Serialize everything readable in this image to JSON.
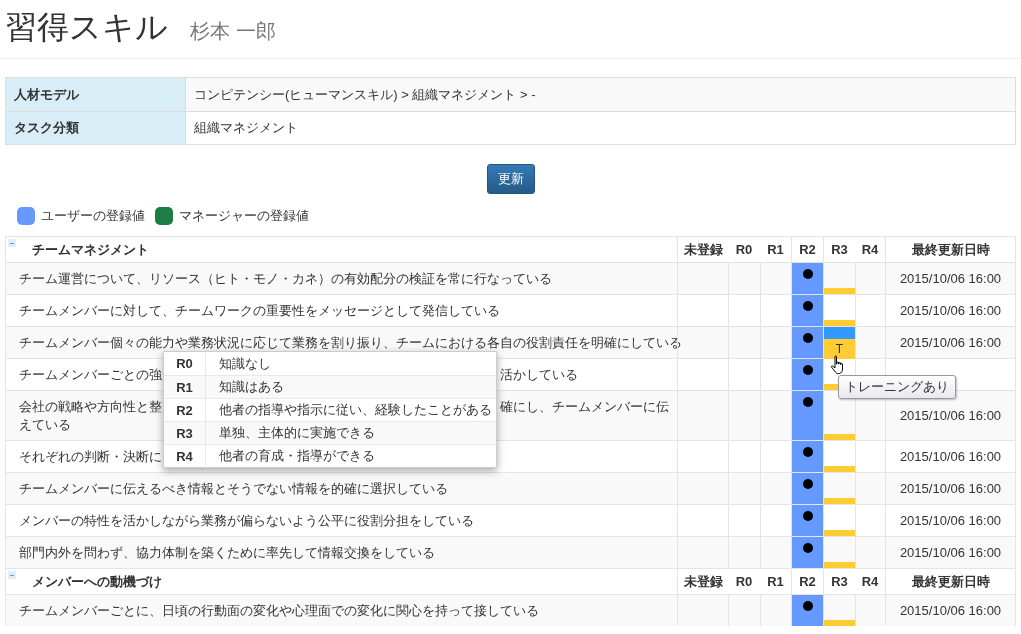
{
  "title": "習得スキル",
  "user_name": "杉本 一郎",
  "info": [
    {
      "label": "人材モデル",
      "value": "コンピテンシー(ヒューマンスキル) > 組織マネジメント > -"
    },
    {
      "label": "タスク分類",
      "value": "組織マネジメント"
    }
  ],
  "update_button": "更新",
  "legend": [
    {
      "label": "ユーザーの登録値",
      "color": "#6699ff"
    },
    {
      "label": "マネージャーの登録値",
      "color": "#1e7e45"
    }
  ],
  "groups": [
    {
      "title": "チームマネジメント",
      "expanded": true,
      "columns": [
        "未登録",
        "R0",
        "R1",
        "R2",
        "R3",
        "R4"
      ],
      "date_header": "最終更新日時",
      "rows": [
        {
          "lines": [
            [
              "チーム運営について、リソース（ヒト・モノ・カネ）の有効配分の検証を常に行なっている"
            ]
          ],
          "cells": [
            {
              "kind": "empty"
            },
            {
              "kind": "empty"
            },
            {
              "kind": "empty"
            },
            {
              "kind": "user"
            },
            {
              "kind": "training"
            },
            {
              "kind": "empty"
            }
          ],
          "date": "2015/10/06 16:00"
        },
        {
          "lines": [
            [
              "チームメンバーに対して、チームワークの重要性をメッセージとして発信している"
            ]
          ],
          "cells": [
            {
              "kind": "empty"
            },
            {
              "kind": "empty"
            },
            {
              "kind": "empty"
            },
            {
              "kind": "user"
            },
            {
              "kind": "training"
            },
            {
              "kind": "empty"
            }
          ],
          "date": "2015/10/06 16:00"
        },
        {
          "lines": [
            [
              "チームメンバー個々の能力や業務状況に応じて業務を割り振り、チームにおける各自の役割責任を明確にしている"
            ]
          ],
          "cells": [
            {
              "kind": "empty"
            },
            {
              "kind": "empty"
            },
            {
              "kind": "empty"
            },
            {
              "kind": "user"
            },
            {
              "kind": "training_hovered",
              "label": "T"
            },
            {
              "kind": "empty"
            }
          ],
          "date": "2015/10/06 16:00"
        },
        {
          "lines": [
            [
              "チームメンバーごとの強",
              "活かしている"
            ]
          ],
          "cells": [
            {
              "kind": "empty"
            },
            {
              "kind": "empty"
            },
            {
              "kind": "empty"
            },
            {
              "kind": "user"
            },
            {
              "kind": "training"
            },
            {
              "kind": "empty"
            }
          ]
        },
        {
          "lines": [
            [
              "会社の戦略や方向性と整",
              "確にし、チームメンバーに伝"
            ],
            [
              "えている"
            ]
          ],
          "cells": [
            {
              "kind": "empty"
            },
            {
              "kind": "empty"
            },
            {
              "kind": "empty"
            },
            {
              "kind": "user"
            },
            {
              "kind": "training"
            },
            {
              "kind": "empty"
            }
          ],
          "date": "2015/10/06 16:00"
        },
        {
          "lines": [
            [
              "それぞれの判断・決断に"
            ]
          ],
          "cells": [
            {
              "kind": "empty"
            },
            {
              "kind": "empty"
            },
            {
              "kind": "empty"
            },
            {
              "kind": "user"
            },
            {
              "kind": "training"
            },
            {
              "kind": "empty"
            }
          ],
          "date": "2015/10/06 16:00"
        },
        {
          "lines": [
            [
              "チームメンバーに伝えるべき情報とそうでない情報を的確に選択している"
            ]
          ],
          "cells": [
            {
              "kind": "empty"
            },
            {
              "kind": "empty"
            },
            {
              "kind": "empty"
            },
            {
              "kind": "user"
            },
            {
              "kind": "training"
            },
            {
              "kind": "empty"
            }
          ],
          "date": "2015/10/06 16:00"
        },
        {
          "lines": [
            [
              "メンバーの特性を活かしながら業務が偏らないよう公平に役割分担をしている"
            ]
          ],
          "cells": [
            {
              "kind": "empty"
            },
            {
              "kind": "empty"
            },
            {
              "kind": "empty"
            },
            {
              "kind": "user"
            },
            {
              "kind": "training"
            },
            {
              "kind": "empty"
            }
          ],
          "date": "2015/10/06 16:00"
        },
        {
          "lines": [
            [
              "部門内外を問わず、協力体制を築くために率先して情報交換をしている"
            ]
          ],
          "cells": [
            {
              "kind": "empty"
            },
            {
              "kind": "empty"
            },
            {
              "kind": "empty"
            },
            {
              "kind": "user"
            },
            {
              "kind": "training"
            },
            {
              "kind": "empty"
            }
          ],
          "date": "2015/10/06 16:00"
        }
      ]
    },
    {
      "title": "メンバーへの動機づけ",
      "expanded": true,
      "columns": [
        "未登録",
        "R0",
        "R1",
        "R2",
        "R3",
        "R4"
      ],
      "date_header": "最終更新日時",
      "rows": [
        {
          "lines": [
            [
              "チームメンバーごとに、日頃の行動面の変化や心理面での変化に関心を持って接している"
            ]
          ],
          "cells": [
            {
              "kind": "empty"
            },
            {
              "kind": "empty"
            },
            {
              "kind": "empty"
            },
            {
              "kind": "user"
            },
            {
              "kind": "training"
            },
            {
              "kind": "empty"
            }
          ],
          "date": "2015/10/06 16:00"
        }
      ]
    }
  ],
  "level_popover": [
    {
      "level": "R0",
      "desc": "知識なし"
    },
    {
      "level": "R1",
      "desc": "知識はある"
    },
    {
      "level": "R2",
      "desc": "他者の指導や指示に従い、経験したことがある"
    },
    {
      "level": "R3",
      "desc": "単独、主体的に実施できる"
    },
    {
      "level": "R4",
      "desc": "他者の育成・指導ができる"
    }
  ],
  "tooltip": "トレーニングあり"
}
